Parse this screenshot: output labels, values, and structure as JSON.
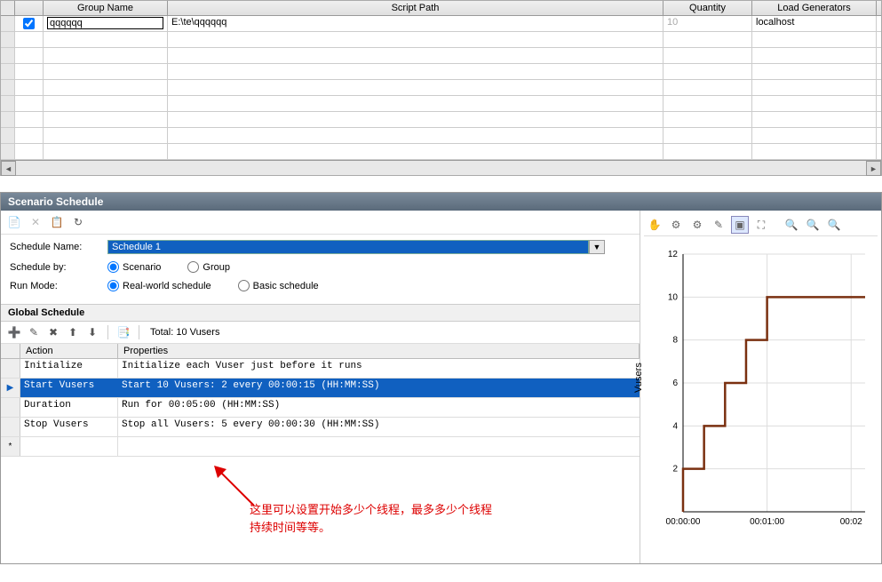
{
  "top_grid": {
    "headers": {
      "group_name": "Group Name",
      "script_path": "Script Path",
      "quantity": "Quantity",
      "load_generators": "Load Generators"
    },
    "row": {
      "checked": true,
      "group_name": "qqqqqq",
      "script_path": "E:\\te\\qqqqqq",
      "quantity": "10",
      "load_generators": "localhost"
    }
  },
  "panel": {
    "title": "Scenario Schedule"
  },
  "form": {
    "schedule_name_lbl": "Schedule Name:",
    "schedule_name_val": "Schedule 1",
    "schedule_by_lbl": "Schedule by:",
    "scenario_opt": "Scenario",
    "group_opt": "Group",
    "run_mode_lbl": "Run Mode:",
    "realworld_opt": "Real-world schedule",
    "basic_opt": "Basic schedule"
  },
  "global_schedule": {
    "title": "Global Schedule",
    "total": "Total: 10 Vusers",
    "headers": {
      "action": "Action",
      "properties": "Properties"
    },
    "rows": [
      {
        "action": "Initialize",
        "properties": "Initialize each Vuser just before it runs"
      },
      {
        "action": "Start  Vusers",
        "properties": "Start 10 Vusers: 2 every 00:00:15 (HH:MM:SS)"
      },
      {
        "action": "Duration",
        "properties": "Run for 00:05:00 (HH:MM:SS)"
      },
      {
        "action": "Stop Vusers",
        "properties": "Stop all Vusers: 5 every 00:00:30 (HH:MM:SS)"
      }
    ],
    "selected_index": 1
  },
  "annotation": {
    "line1": "这里可以设置开始多少个线程，最多多少个线程",
    "line2": "持续时间等等。"
  },
  "chart_data": {
    "type": "line",
    "ylabel": "Vusers",
    "ylim": [
      0,
      12
    ],
    "yticks": [
      2,
      4,
      6,
      8,
      10,
      12
    ],
    "xticks": [
      "00:00:00",
      "00:01:00",
      "00:02"
    ],
    "series": [
      {
        "name": "Vusers",
        "points": [
          {
            "t": 0,
            "v": 0
          },
          {
            "t": 0,
            "v": 2
          },
          {
            "t": 15,
            "v": 2
          },
          {
            "t": 15,
            "v": 4
          },
          {
            "t": 30,
            "v": 4
          },
          {
            "t": 30,
            "v": 6
          },
          {
            "t": 45,
            "v": 6
          },
          {
            "t": 45,
            "v": 8
          },
          {
            "t": 60,
            "v": 8
          },
          {
            "t": 60,
            "v": 10
          },
          {
            "t": 130,
            "v": 10
          }
        ]
      }
    ]
  }
}
